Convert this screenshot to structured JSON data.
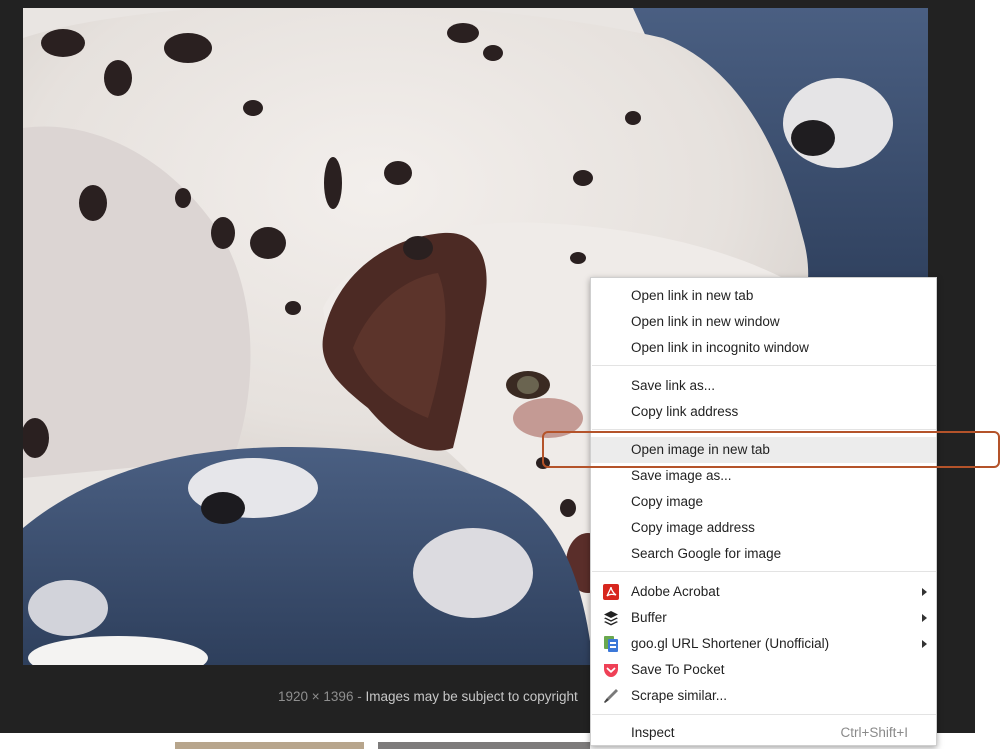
{
  "image_viewer": {
    "dimensions": "1920 × 1396",
    "separator": " - ",
    "copyright_notice": "Images may be subject to copyright"
  },
  "context_menu": {
    "groups": [
      {
        "items": [
          {
            "label": "Open link in new tab"
          },
          {
            "label": "Open link in new window"
          },
          {
            "label": "Open link in incognito window"
          }
        ]
      },
      {
        "items": [
          {
            "label": "Save link as..."
          },
          {
            "label": "Copy link address"
          }
        ]
      },
      {
        "items": [
          {
            "label": "Open image in new tab",
            "highlighted": true
          },
          {
            "label": "Save image as..."
          },
          {
            "label": "Copy image"
          },
          {
            "label": "Copy image address"
          },
          {
            "label": "Search Google for image"
          }
        ]
      },
      {
        "items": [
          {
            "label": "Adobe Acrobat",
            "icon": "adobe-acrobat-icon",
            "submenu": true
          },
          {
            "label": "Buffer",
            "icon": "buffer-icon",
            "submenu": true
          },
          {
            "label": "goo.gl URL Shortener (Unofficial)",
            "icon": "googl-shortener-icon",
            "submenu": true
          },
          {
            "label": "Save To Pocket",
            "icon": "pocket-icon"
          },
          {
            "label": "Scrape similar...",
            "icon": "scraper-icon"
          }
        ]
      },
      {
        "items": [
          {
            "label": "Inspect",
            "shortcut": "Ctrl+Shift+I"
          }
        ]
      }
    ]
  },
  "colors": {
    "viewer_background": "#222222",
    "menu_hover": "#ececec",
    "annotation_outline": "#b4532a",
    "acrobat_red": "#d7261e",
    "pocket_red": "#ef4056"
  }
}
